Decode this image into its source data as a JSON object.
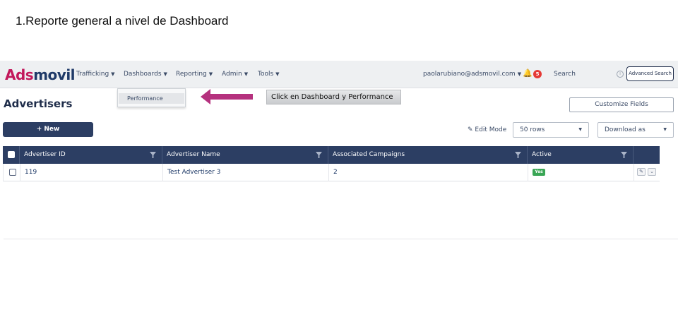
{
  "slide": {
    "title": "1.Reporte general a nivel de Dashboard"
  },
  "navbar": {
    "logo_part1": "Ads",
    "logo_part2": "movil",
    "menu": [
      {
        "label": "Trafficking"
      },
      {
        "label": "Dashboards"
      },
      {
        "label": "Reporting"
      },
      {
        "label": "Admin"
      },
      {
        "label": "Tools"
      }
    ],
    "user_email": "paolarubiano@adsmovil.com",
    "notification_count": "5",
    "search_label": "Search",
    "advanced_search": "Advanced Search"
  },
  "dropdown": {
    "items": [
      {
        "label": "Performance"
      }
    ]
  },
  "annotation": {
    "callout_text": "Click en Dashboard y Performance",
    "arrow_color": "#b5317e"
  },
  "page": {
    "title": "Advertisers",
    "customize_fields": "Customize Fields",
    "new_button": "+ New",
    "edit_mode": "Edit Mode",
    "rows_select": "50 rows",
    "download_select": "Download as"
  },
  "table": {
    "columns": [
      {
        "label": "Advertiser ID"
      },
      {
        "label": "Advertiser Name"
      },
      {
        "label": "Associated Campaigns"
      },
      {
        "label": "Active"
      }
    ],
    "rows": [
      {
        "id": "119",
        "name": "Test Advertiser 3",
        "campaigns": "2",
        "active": "Yes"
      }
    ]
  },
  "colors": {
    "brand_pink": "#c2185b",
    "brand_navy": "#1f3a68",
    "header_bg": "#2c3e63",
    "active_green": "#3aa655",
    "badge_red": "#e53935"
  }
}
